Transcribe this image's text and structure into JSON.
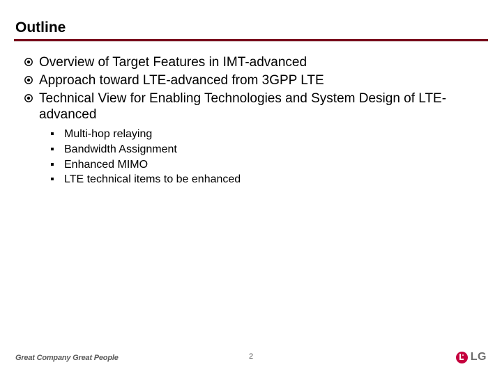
{
  "title": "Outline",
  "bullets": [
    {
      "text": "Overview of Target Features in IMT-advanced"
    },
    {
      "text": "Approach toward LTE-advanced from 3GPP LTE"
    },
    {
      "text": "Technical View for Enabling Technologies and System Design of LTE-advanced"
    }
  ],
  "sub_bullets": [
    {
      "text": "Multi-hop relaying"
    },
    {
      "text": "Bandwidth Assignment"
    },
    {
      "text": "Enhanced MIMO"
    },
    {
      "text": "LTE technical items to be enhanced"
    }
  ],
  "footer": {
    "tagline": "Great Company Great People",
    "page": "2",
    "brand": "LG"
  },
  "colors": {
    "rule_dark": "#7a0f1e",
    "brand_red": "#c5003e"
  }
}
